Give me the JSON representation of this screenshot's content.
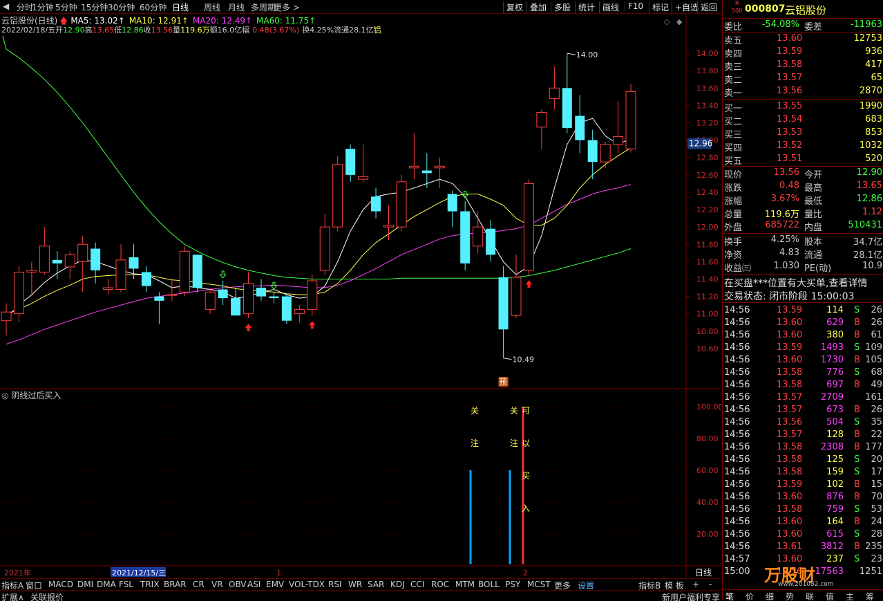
{
  "toolbar": {
    "periods": [
      "分时",
      "1分钟",
      "5分钟",
      "15分钟",
      "30分钟",
      "60分钟",
      "日线",
      "周线",
      "月线",
      "多周期",
      "更多 >"
    ],
    "active": "日线",
    "right": [
      "复权",
      "叠加",
      "多股",
      "统计",
      "画线",
      "F10",
      "标记",
      "+自选",
      "返回"
    ]
  },
  "chart": {
    "title": "云铝股份(日线)",
    "ma": [
      {
        "label": "MA5: 13.02",
        "color": "#ffffff"
      },
      {
        "label": "MA10: 12.91",
        "color": "#ffff50"
      },
      {
        "label": "MA20: 12.49",
        "color": "#ff40ff"
      },
      {
        "label": "MA60: 11.75",
        "color": "#40ff40"
      }
    ],
    "ohlc": [
      {
        "t": "2022/02/18/五",
        "c": "#c8c8c8"
      },
      {
        "t": "开",
        "c": "#c8c8c8"
      },
      {
        "t": "12.90",
        "c": "#40ff40"
      },
      {
        "t": "高",
        "c": "#c8c8c8"
      },
      {
        "t": "13.65",
        "c": "#ff4040"
      },
      {
        "t": "低",
        "c": "#c8c8c8"
      },
      {
        "t": "12.86",
        "c": "#40ff40"
      },
      {
        "t": "收",
        "c": "#c8c8c8"
      },
      {
        "t": "13.56",
        "c": "#ff4040"
      },
      {
        "t": "量",
        "c": "#c8c8c8"
      },
      {
        "t": "119.6万",
        "c": "#ffff50"
      },
      {
        "t": "额16.0亿",
        "c": "#c8c8c8"
      },
      {
        "t": "幅",
        "c": "#c8c8c8"
      },
      {
        "t": "0.48(3.67%)",
        "c": "#ff4040"
      },
      {
        "t": "换4.25%",
        "c": "#c8c8c8"
      },
      {
        "t": "流通28.1亿",
        "c": "#c8c8c8"
      },
      {
        "t": "铝",
        "c": "#ffff50"
      }
    ],
    "price_ticks": [
      "14.00",
      "13.80",
      "13.60",
      "13.40",
      "13.20",
      "13.00",
      "12.80",
      "12.60",
      "12.40",
      "12.20",
      "12.00",
      "11.80",
      "11.60",
      "11.40",
      "11.20",
      "11.00",
      "10.80",
      "10.60"
    ],
    "current_price_label": "12.96",
    "high_label": "14.00",
    "low_label": "10.49",
    "pre_tag": "预",
    "date_labels": [
      {
        "text": "2021年",
        "hl": false
      },
      {
        "text": "2021/12/15/三",
        "hl": true
      },
      {
        "text": "1",
        "hl": false
      },
      {
        "text": "2",
        "hl": false
      }
    ],
    "period_tag": "日线"
  },
  "indicator": {
    "title": "阴线过后买入",
    "ticks": [
      "100.00",
      "80.00",
      "60.00",
      "40.00",
      "20.00"
    ],
    "signals": [
      {
        "chars": [
          "关",
          "注"
        ],
        "color": "#ffff50",
        "value": 60,
        "bar": "#00a8ff"
      },
      {
        "chars": [
          "关",
          "注"
        ],
        "color": "#ffff50",
        "value": 60,
        "bar": "#00a8ff"
      },
      {
        "chars": [
          "可",
          "以",
          "买",
          "入"
        ],
        "color": "#ffff50",
        "value": 100,
        "bar": "#ff3030"
      }
    ]
  },
  "chart_data": {
    "type": "candlestick",
    "ylim": [
      10.4,
      14.2
    ],
    "candles": [
      {
        "o": 10.92,
        "h": 11.12,
        "l": 10.75,
        "c": 11.02
      },
      {
        "o": 11.0,
        "h": 11.55,
        "l": 10.9,
        "c": 11.48
      },
      {
        "o": 11.48,
        "h": 11.6,
        "l": 11.2,
        "c": 11.5
      },
      {
        "o": 11.48,
        "h": 12.0,
        "l": 11.45,
        "c": 11.78
      },
      {
        "o": 11.62,
        "h": 11.72,
        "l": 11.4,
        "c": 11.58
      },
      {
        "o": 11.54,
        "h": 11.72,
        "l": 11.4,
        "c": 11.68
      },
      {
        "o": 11.6,
        "h": 11.9,
        "l": 11.25,
        "c": 11.8
      },
      {
        "o": 11.75,
        "h": 11.82,
        "l": 11.35,
        "c": 11.5
      },
      {
        "o": 11.28,
        "h": 11.4,
        "l": 11.22,
        "c": 11.3
      },
      {
        "o": 11.28,
        "h": 11.8,
        "l": 11.25,
        "c": 11.62
      },
      {
        "o": 11.65,
        "h": 11.8,
        "l": 11.4,
        "c": 11.52
      },
      {
        "o": 11.48,
        "h": 11.55,
        "l": 11.25,
        "c": 11.32
      },
      {
        "o": 11.2,
        "h": 11.25,
        "l": 10.88,
        "c": 11.15
      },
      {
        "o": 11.22,
        "h": 11.4,
        "l": 11.15,
        "c": 11.22
      },
      {
        "o": 11.25,
        "h": 11.78,
        "l": 11.2,
        "c": 11.72
      },
      {
        "o": 11.68,
        "h": 11.68,
        "l": 11.25,
        "c": 11.3
      },
      {
        "o": 11.05,
        "h": 11.3,
        "l": 11.0,
        "c": 11.25
      },
      {
        "o": 11.28,
        "h": 11.38,
        "l": 11.1,
        "c": 11.18
      },
      {
        "o": 11.18,
        "h": 11.3,
        "l": 11.05,
        "c": 10.98
      },
      {
        "o": 11.0,
        "h": 11.48,
        "l": 10.95,
        "c": 11.35
      },
      {
        "o": 11.3,
        "h": 11.4,
        "l": 11.15,
        "c": 11.2
      },
      {
        "o": 11.2,
        "h": 11.25,
        "l": 11.12,
        "c": 11.18
      },
      {
        "o": 11.2,
        "h": 11.22,
        "l": 10.88,
        "c": 10.92
      },
      {
        "o": 11.0,
        "h": 11.1,
        "l": 10.9,
        "c": 11.05
      },
      {
        "o": 11.05,
        "h": 11.45,
        "l": 10.98,
        "c": 11.38
      },
      {
        "o": 11.5,
        "h": 12.15,
        "l": 11.45,
        "c": 12.0
      },
      {
        "o": 12.0,
        "h": 12.82,
        "l": 11.95,
        "c": 12.72
      },
      {
        "o": 12.9,
        "h": 12.95,
        "l": 12.52,
        "c": 12.6
      },
      {
        "o": 12.55,
        "h": 12.95,
        "l": 12.52,
        "c": 12.58
      },
      {
        "o": 12.35,
        "h": 12.45,
        "l": 12.1,
        "c": 12.18
      },
      {
        "o": 12.0,
        "h": 12.25,
        "l": 11.85,
        "c": 12.02
      },
      {
        "o": 12.0,
        "h": 12.6,
        "l": 11.95,
        "c": 12.52
      },
      {
        "o": 12.68,
        "h": 13.08,
        "l": 12.55,
        "c": 12.7
      },
      {
        "o": 12.65,
        "h": 12.85,
        "l": 12.45,
        "c": 12.62
      },
      {
        "o": 12.68,
        "h": 12.8,
        "l": 12.45,
        "c": 12.7
      },
      {
        "o": 12.38,
        "h": 12.42,
        "l": 12.0,
        "c": 12.18
      },
      {
        "o": 12.18,
        "h": 12.3,
        "l": 11.5,
        "c": 11.58
      },
      {
        "o": 11.78,
        "h": 12.18,
        "l": 11.7,
        "c": 12.0
      },
      {
        "o": 11.98,
        "h": 12.08,
        "l": 11.6,
        "c": 11.68
      },
      {
        "o": 11.42,
        "h": 11.55,
        "l": 10.49,
        "c": 10.82
      },
      {
        "o": 10.98,
        "h": 11.68,
        "l": 10.95,
        "c": 11.42
      },
      {
        "o": 11.5,
        "h": 12.55,
        "l": 11.45,
        "c": 12.5
      },
      {
        "o": 13.15,
        "h": 13.35,
        "l": 12.9,
        "c": 13.32
      },
      {
        "o": 13.48,
        "h": 13.85,
        "l": 13.35,
        "c": 13.6
      },
      {
        "o": 13.6,
        "h": 14.0,
        "l": 13.08,
        "c": 13.14
      },
      {
        "o": 13.28,
        "h": 13.52,
        "l": 12.85,
        "c": 13.0
      },
      {
        "o": 13.0,
        "h": 13.12,
        "l": 12.55,
        "c": 12.75
      },
      {
        "o": 12.75,
        "h": 12.98,
        "l": 12.68,
        "c": 12.95
      },
      {
        "o": 12.95,
        "h": 13.45,
        "l": 12.85,
        "c": 13.04
      },
      {
        "o": 12.9,
        "h": 13.65,
        "l": 12.86,
        "c": 13.56
      }
    ],
    "ma5": [
      10.95,
      11.1,
      11.22,
      11.36,
      11.47,
      11.55,
      11.62,
      11.6,
      11.55,
      11.5,
      11.46,
      11.45,
      11.38,
      11.3,
      11.32,
      11.3,
      11.28,
      11.25,
      11.18,
      11.2,
      11.25,
      11.28,
      11.22,
      11.18,
      11.2,
      11.32,
      11.6,
      11.95,
      12.2,
      12.35,
      12.38,
      12.4,
      12.45,
      12.5,
      12.55,
      12.5,
      12.35,
      12.1,
      11.85,
      11.6,
      11.45,
      11.55,
      11.9,
      12.45,
      12.95,
      13.2,
      13.25,
      13.05,
      12.95,
      13.02
    ],
    "ma10": [
      11.0,
      11.05,
      11.12,
      11.2,
      11.27,
      11.33,
      11.4,
      11.43,
      11.44,
      11.45,
      11.45,
      11.45,
      11.42,
      11.39,
      11.38,
      11.36,
      11.34,
      11.32,
      11.29,
      11.27,
      11.26,
      11.25,
      11.23,
      11.22,
      11.22,
      11.25,
      11.35,
      11.5,
      11.68,
      11.82,
      11.92,
      12.02,
      12.12,
      12.2,
      12.28,
      12.35,
      12.38,
      12.38,
      12.32,
      12.25,
      12.1,
      12.02,
      12.02,
      12.1,
      12.25,
      12.45,
      12.6,
      12.72,
      12.82,
      12.91
    ],
    "ma20": [
      10.65,
      10.7,
      10.76,
      10.82,
      10.87,
      10.92,
      10.97,
      11.02,
      11.06,
      11.1,
      11.14,
      11.18,
      11.2,
      11.22,
      11.24,
      11.26,
      11.28,
      11.3,
      11.31,
      11.32,
      11.32,
      11.33,
      11.32,
      11.31,
      11.3,
      11.3,
      11.33,
      11.38,
      11.45,
      11.52,
      11.6,
      11.68,
      11.74,
      11.8,
      11.86,
      11.9,
      11.92,
      11.93,
      11.94,
      11.96,
      11.98,
      12.02,
      12.1,
      12.18,
      12.26,
      12.32,
      12.38,
      12.42,
      12.45,
      12.49
    ],
    "ma60": [
      14.05,
      13.95,
      13.83,
      13.7,
      13.55,
      13.38,
      13.2,
      13.0,
      12.8,
      12.6,
      12.4,
      12.22,
      12.06,
      11.92,
      11.8,
      11.72,
      11.65,
      11.59,
      11.54,
      11.5,
      11.47,
      11.44,
      11.42,
      11.41,
      11.4,
      11.4,
      11.4,
      11.4,
      11.4,
      11.4,
      11.4,
      11.41,
      11.41,
      11.41,
      11.41,
      11.41,
      11.41,
      11.41,
      11.41,
      11.41,
      11.42,
      11.44,
      11.47,
      11.5,
      11.54,
      11.58,
      11.62,
      11.66,
      11.7,
      11.75
    ],
    "up_arrows": [
      19,
      24,
      41
    ],
    "down_arrows": [
      17,
      21,
      36
    ]
  },
  "quote": {
    "badge_top": "R",
    "badge_bottom": "500",
    "code": "000807",
    "name": "云铝股份",
    "weibi_label": "委比",
    "weibi": "-54.08%",
    "weicha_label": "委差",
    "weicha": "-11963",
    "asks": [
      {
        "label": "卖五",
        "price": "13.60",
        "vol": "12753"
      },
      {
        "label": "卖四",
        "price": "13.59",
        "vol": "936"
      },
      {
        "label": "卖三",
        "price": "13.58",
        "vol": "417"
      },
      {
        "label": "卖二",
        "price": "13.57",
        "vol": "65"
      },
      {
        "label": "卖一",
        "price": "13.56",
        "vol": "2870"
      }
    ],
    "bids": [
      {
        "label": "买一",
        "price": "13.55",
        "vol": "1990"
      },
      {
        "label": "买二",
        "price": "13.54",
        "vol": "683"
      },
      {
        "label": "买三",
        "price": "13.53",
        "vol": "853"
      },
      {
        "label": "买四",
        "price": "13.52",
        "vol": "1032"
      },
      {
        "label": "买五",
        "price": "13.51",
        "vol": "520"
      }
    ],
    "stats": [
      {
        "l1": "现价",
        "v1": "13.56",
        "c1": "#ff4040",
        "l2": "今开",
        "v2": "12.90",
        "c2": "#40ff40"
      },
      {
        "l1": "涨跌",
        "v1": "0.48",
        "c1": "#ff4040",
        "l2": "最高",
        "v2": "13.65",
        "c2": "#ff4040"
      },
      {
        "l1": "涨幅",
        "v1": "3.67%",
        "c1": "#ff4040",
        "l2": "最低",
        "v2": "12.86",
        "c2": "#40ff40"
      },
      {
        "l1": "总量",
        "v1": "119.6万",
        "c1": "#ffff50",
        "l2": "量比",
        "v2": "1.12",
        "c2": "#ff4040"
      },
      {
        "l1": "外盘",
        "v1": "685722",
        "c1": "#ff4040",
        "l2": "内盘",
        "v2": "510431",
        "c2": "#40ff40"
      }
    ],
    "stats2": [
      {
        "l1": "换手",
        "v1": "4.25%",
        "l2": "股本",
        "v2": "34.7亿"
      },
      {
        "l1": "净资",
        "v1": "4.83",
        "l2": "流通",
        "v2": "28.1亿"
      },
      {
        "l1": "收益㈢",
        "v1": "1.030",
        "l2": "PE(动)",
        "v2": "10.9"
      }
    ],
    "notice": "在买盘***位置有大买单,查看详情",
    "trade_status": "交易状态: 闭市阶段 15:00:03",
    "ticks": [
      {
        "t": "14:56",
        "p": "13.59",
        "v": "114",
        "s": "S",
        "n": "26"
      },
      {
        "t": "14:56",
        "p": "13.60",
        "v": "629",
        "s": "B",
        "n": "26"
      },
      {
        "t": "14:56",
        "p": "13.60",
        "v": "380",
        "s": "B",
        "n": "61"
      },
      {
        "t": "14:56",
        "p": "13.59",
        "v": "1493",
        "s": "S",
        "n": "109"
      },
      {
        "t": "14:56",
        "p": "13.60",
        "v": "1730",
        "s": "B",
        "n": "105"
      },
      {
        "t": "14:56",
        "p": "13.58",
        "v": "776",
        "s": "S",
        "n": "68"
      },
      {
        "t": "14:56",
        "p": "13.58",
        "v": "697",
        "s": "B",
        "n": "49"
      },
      {
        "t": "14:56",
        "p": "13.57",
        "v": "2709",
        "s": "",
        "n": "161"
      },
      {
        "t": "14:56",
        "p": "13.57",
        "v": "673",
        "s": "B",
        "n": "26"
      },
      {
        "t": "14:56",
        "p": "13.56",
        "v": "504",
        "s": "S",
        "n": "35"
      },
      {
        "t": "14:56",
        "p": "13.57",
        "v": "128",
        "s": "B",
        "n": "22"
      },
      {
        "t": "14:56",
        "p": "13.58",
        "v": "2308",
        "s": "B",
        "n": "177"
      },
      {
        "t": "14:56",
        "p": "13.58",
        "v": "125",
        "s": "S",
        "n": "20"
      },
      {
        "t": "14:56",
        "p": "13.58",
        "v": "159",
        "s": "S",
        "n": "17"
      },
      {
        "t": "14:56",
        "p": "13.59",
        "v": "102",
        "s": "B",
        "n": "15"
      },
      {
        "t": "14:56",
        "p": "13.60",
        "v": "876",
        "s": "B",
        "n": "70"
      },
      {
        "t": "14:56",
        "p": "13.58",
        "v": "759",
        "s": "S",
        "n": "53"
      },
      {
        "t": "14:56",
        "p": "13.60",
        "v": "164",
        "s": "B",
        "n": "24"
      },
      {
        "t": "14:56",
        "p": "13.60",
        "v": "615",
        "s": "S",
        "n": "28"
      },
      {
        "t": "14:56",
        "p": "13.61",
        "v": "3812",
        "s": "B",
        "n": "235"
      },
      {
        "t": "14:57",
        "p": "13.60",
        "v": "237",
        "s": "S",
        "n": "23"
      },
      {
        "t": "15:00",
        "p": "13.56",
        "v": "17563",
        "s": "",
        "n": "1251"
      }
    ],
    "footer": [
      "笔",
      "价",
      "细",
      "势",
      "联",
      "值",
      "主",
      "筹"
    ],
    "watermark": "万股财",
    "watermark_url": "www.201082.com"
  },
  "tabs": {
    "items": [
      "指标A",
      "窗口",
      "MACD",
      "DMI",
      "DMA",
      "FSL",
      "TRIX",
      "BRAR",
      "CR",
      "VR",
      "OBV",
      "ASI",
      "EMV",
      "VOL-TDX",
      "RSI",
      "WR",
      "SAR",
      "KDJ",
      "CCI",
      "ROC",
      "MTM",
      "BOLL",
      "PSY",
      "MCST",
      "更多",
      "设置"
    ],
    "right": [
      "指标B",
      "模 板",
      "+",
      "-"
    ]
  },
  "status": {
    "expand": "扩展∧",
    "linked": "关联报价",
    "promo": "新用户福利专享"
  }
}
